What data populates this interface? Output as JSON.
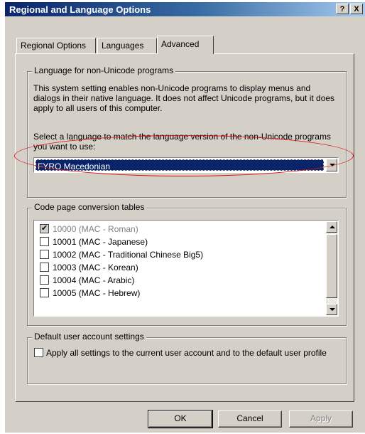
{
  "window": {
    "title": "Regional and Language Options",
    "help_button": "?",
    "close_button": "X"
  },
  "tabs": [
    {
      "label": "Regional Options",
      "active": false
    },
    {
      "label": "Languages",
      "active": false
    },
    {
      "label": "Advanced",
      "active": true
    }
  ],
  "non_unicode": {
    "group_title": "Language for non-Unicode programs",
    "description": "This system setting enables non-Unicode programs to display menus and dialogs in their native language. It does not affect Unicode programs, but it does apply to all users of this computer.",
    "select_prompt": "Select a language to match the language version of the non-Unicode programs you want to use:",
    "selected_language": "FYRO Macedonian"
  },
  "code_pages": {
    "group_title": "Code page conversion tables",
    "items": [
      {
        "label": "10000 (MAC - Roman)",
        "checked": true,
        "disabled": true
      },
      {
        "label": "10001 (MAC - Japanese)",
        "checked": false,
        "disabled": false
      },
      {
        "label": "10002 (MAC - Traditional Chinese Big5)",
        "checked": false,
        "disabled": false
      },
      {
        "label": "10003 (MAC - Korean)",
        "checked": false,
        "disabled": false
      },
      {
        "label": "10004 (MAC - Arabic)",
        "checked": false,
        "disabled": false
      },
      {
        "label": "10005 (MAC - Hebrew)",
        "checked": false,
        "disabled": false
      }
    ]
  },
  "default_user": {
    "group_title": "Default user account settings",
    "apply_all_label": "Apply all settings to the current user account and to the default user profile",
    "apply_all_checked": false
  },
  "buttons": {
    "ok": "OK",
    "cancel": "Cancel",
    "apply": "Apply"
  },
  "colors": {
    "selection": "#0a246a",
    "annotation": "#e01010",
    "dialog_face": "#d4d0c8"
  }
}
